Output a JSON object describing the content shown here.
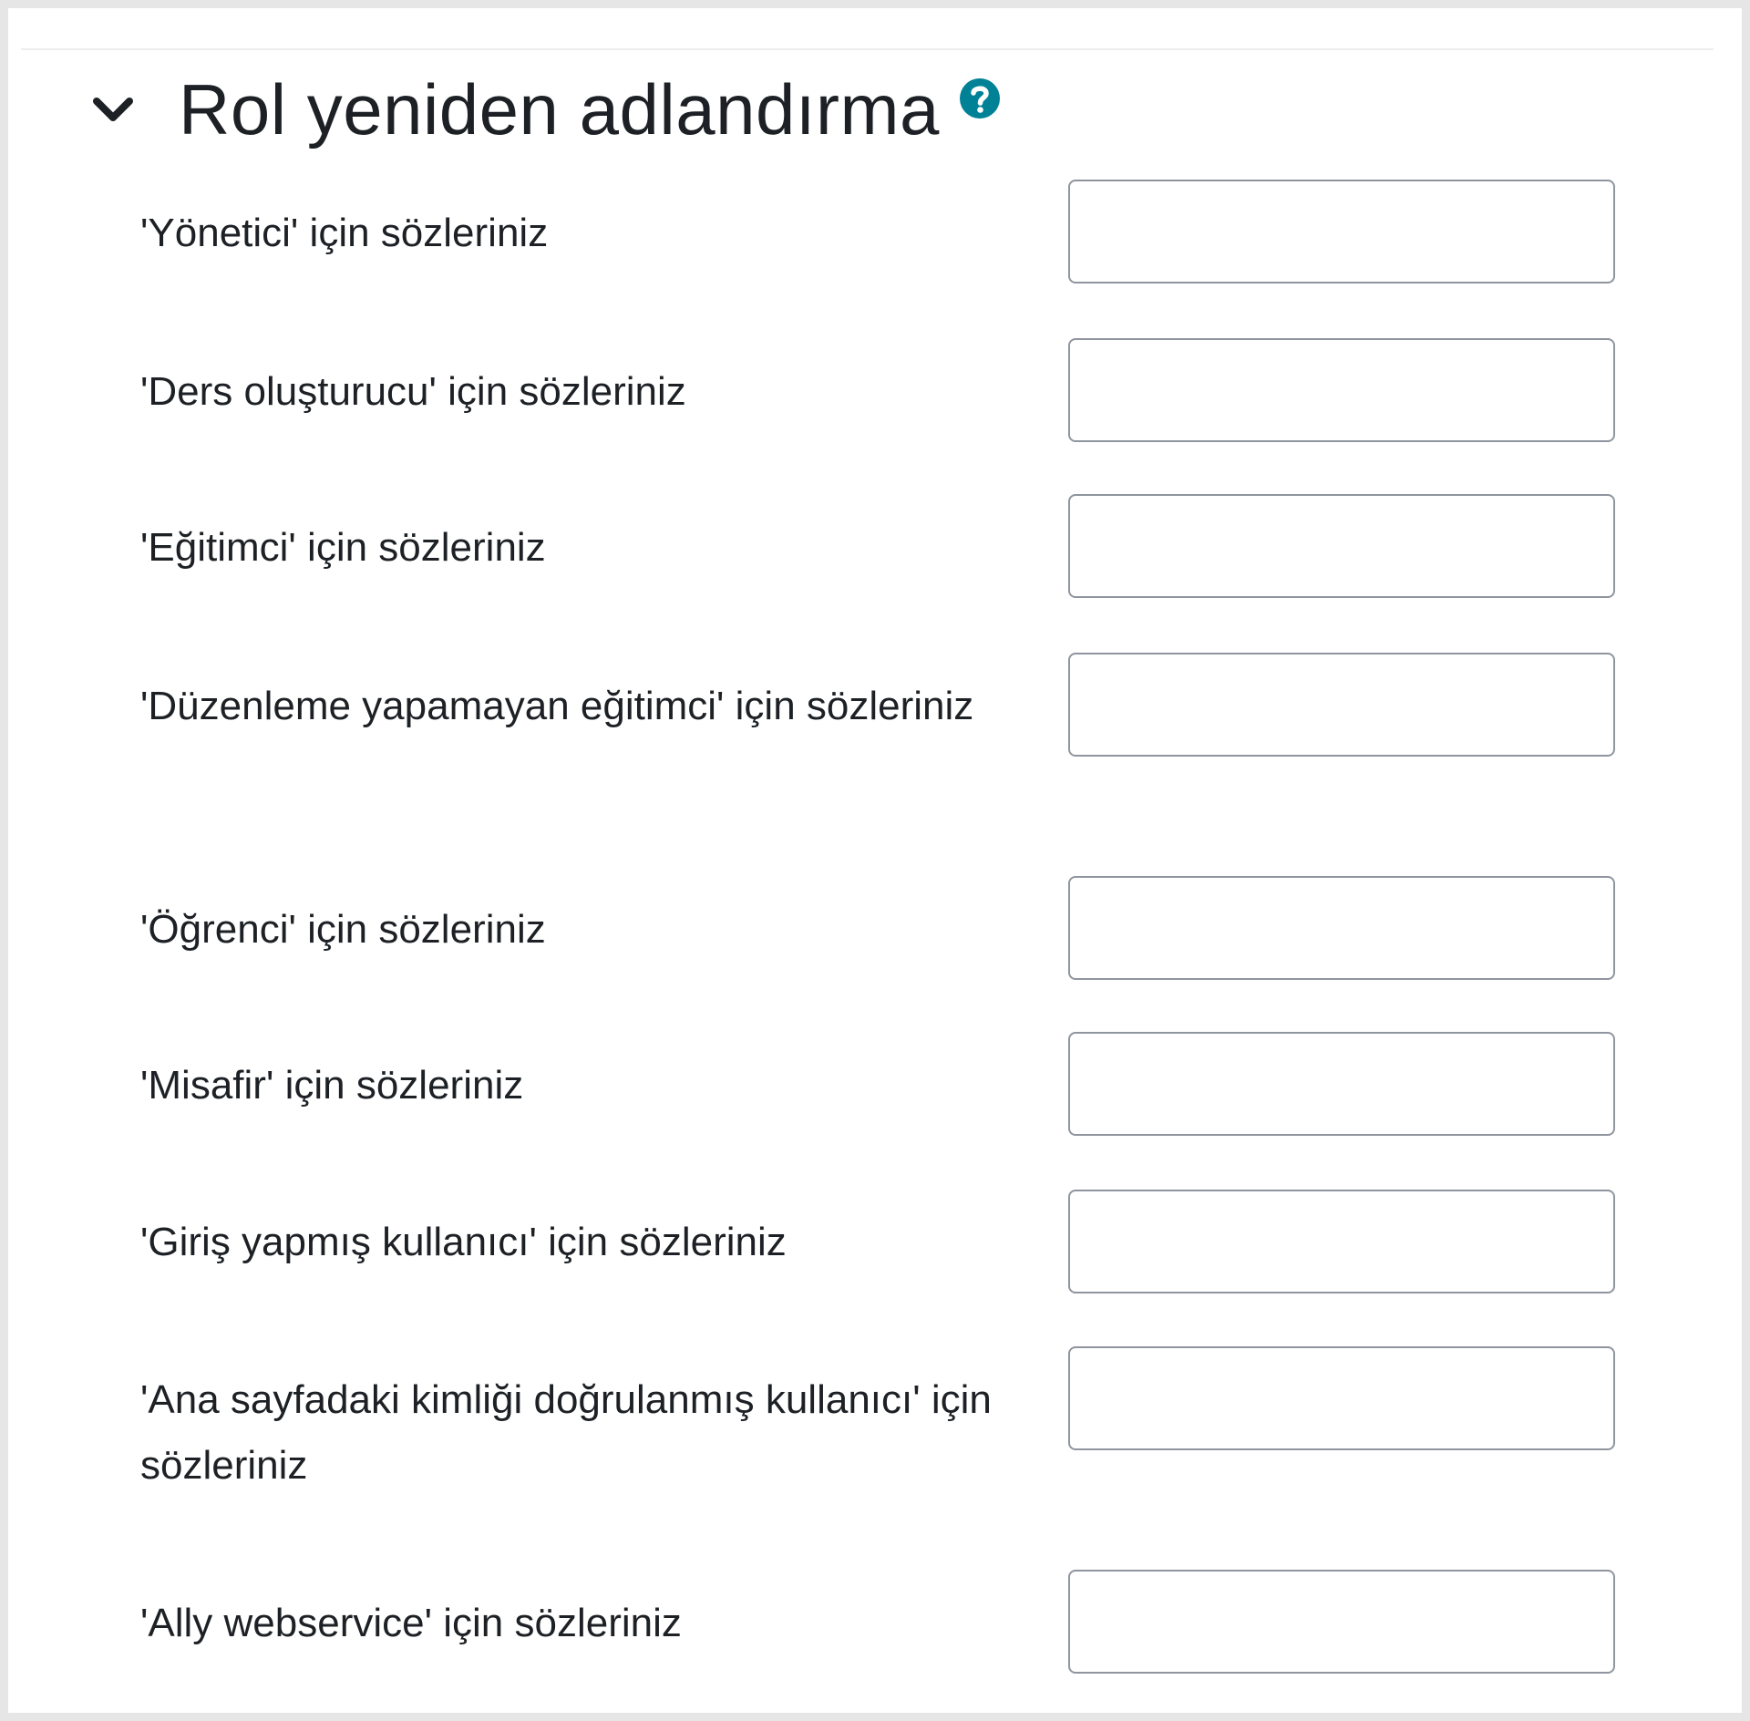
{
  "section": {
    "title": "Rol yeniden adlandırma",
    "toggle_icon": "chevron-down-icon",
    "help_icon": "question-circle-icon",
    "accent_color": "#0f6cbf",
    "help_color": "#008196"
  },
  "roles": [
    {
      "label": "'Yönetici' için sözleriniz",
      "value": ""
    },
    {
      "label": "'Ders oluşturucu' için sözleriniz",
      "value": ""
    },
    {
      "label": "'Eğitimci' için sözleriniz",
      "value": ""
    },
    {
      "label": "'Düzenleme yapamayan eğitimci' için sözleriniz",
      "value": ""
    },
    {
      "label": "'Öğrenci' için sözleriniz",
      "value": ""
    },
    {
      "label": "'Misafir' için sözleriniz",
      "value": ""
    },
    {
      "label": "'Giriş yapmış kullanıcı' için sözleriniz",
      "value": ""
    },
    {
      "label": "'Ana sayfadaki kimliği doğrulanmış kullanıcı' için sözleriniz",
      "value": ""
    },
    {
      "label": "'Ally webservice' için sözleriniz",
      "value": ""
    }
  ]
}
